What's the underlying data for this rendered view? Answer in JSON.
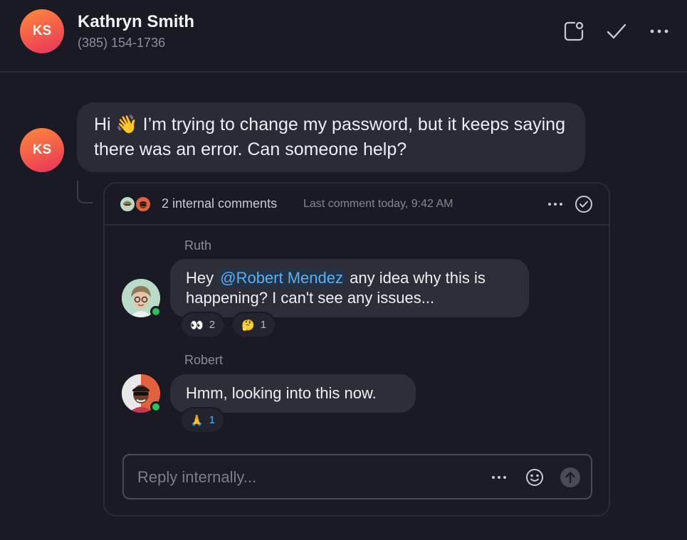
{
  "header": {
    "avatar_initials": "KS",
    "name": "Kathryn Smith",
    "phone": "(385) 154-1736",
    "actions": [
      "note-icon",
      "check-icon",
      "more-icon"
    ]
  },
  "message": {
    "avatar_initials": "KS",
    "text_before_emoji": "Hi",
    "emoji": "👋",
    "text_after_emoji": "I’m trying to change my password, but it keeps saying there was an error. Can someone help?"
  },
  "thread": {
    "count_label": "2 internal comments",
    "last_comment_label": "Last comment today, 9:42 AM",
    "comments": [
      {
        "author": "Ruth",
        "text_before_mention": "Hey",
        "mention": "@Robert Mendez",
        "text_after_mention": "any idea why this is happening? I can't see any issues...",
        "reactions": [
          {
            "emoji": "👀",
            "count": "2"
          },
          {
            "emoji": "🤔",
            "count": "1"
          }
        ]
      },
      {
        "author": "Robert",
        "text": "Hmm, looking into this now.",
        "reactions": [
          {
            "emoji": "🙏",
            "count": "1"
          }
        ]
      }
    ]
  },
  "reply": {
    "placeholder": "Reply internally..."
  },
  "colors": {
    "background": "#1a1a24",
    "bubble": "#2b2b38",
    "mention": "#5ab0f5",
    "online": "#2fc25b",
    "avatar_gradient": [
      "#fb8a3c",
      "#e8325e"
    ]
  }
}
